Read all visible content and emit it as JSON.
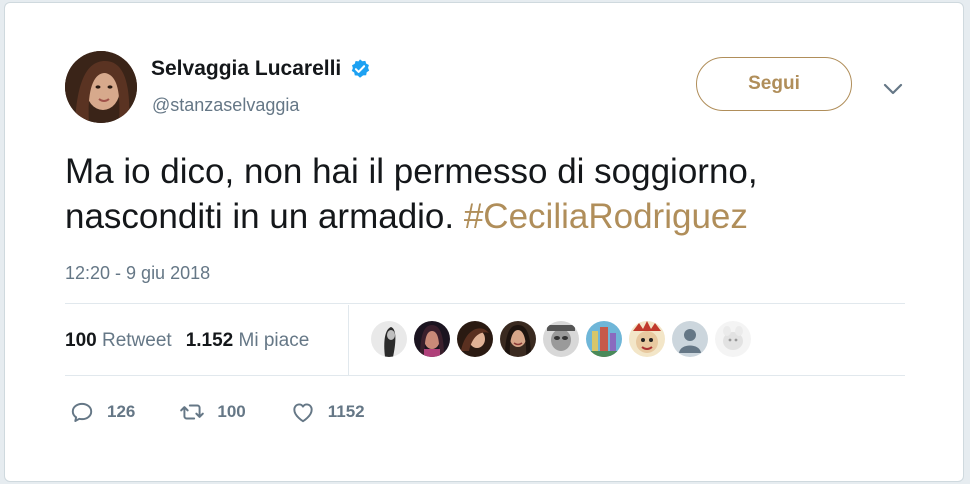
{
  "author": {
    "name": "Selvaggia Lucarelli",
    "handle": "@stanzaselvaggia",
    "verified_icon": "verified-badge-icon"
  },
  "follow_button": {
    "label": "Segui"
  },
  "more_icon": "chevron-down-icon",
  "tweet": {
    "text_part1": "Ma io dico, non hai il permesso di soggiorno, nasconditi in un armadio. ",
    "hashtag": "#CeciliaRodriguez",
    "timestamp": "12:20 - 9 giu 2018"
  },
  "stats": {
    "retweets_count": "100",
    "retweets_label": "Retweet",
    "likes_count": "1.152",
    "likes_label": "Mi piace"
  },
  "likers": [
    {
      "name": "liker-avatar"
    },
    {
      "name": "liker-avatar"
    },
    {
      "name": "liker-avatar"
    },
    {
      "name": "liker-avatar"
    },
    {
      "name": "liker-avatar"
    },
    {
      "name": "liker-avatar"
    },
    {
      "name": "liker-avatar"
    },
    {
      "name": "default-profile-avatar"
    },
    {
      "name": "liker-avatar"
    }
  ],
  "actions": {
    "reply_count": "126",
    "retweet_count": "100",
    "like_count": "1152"
  },
  "colors": {
    "accent": "#b08e5a",
    "text": "#14171a",
    "muted": "#657786",
    "verified": "#1da1f2"
  }
}
